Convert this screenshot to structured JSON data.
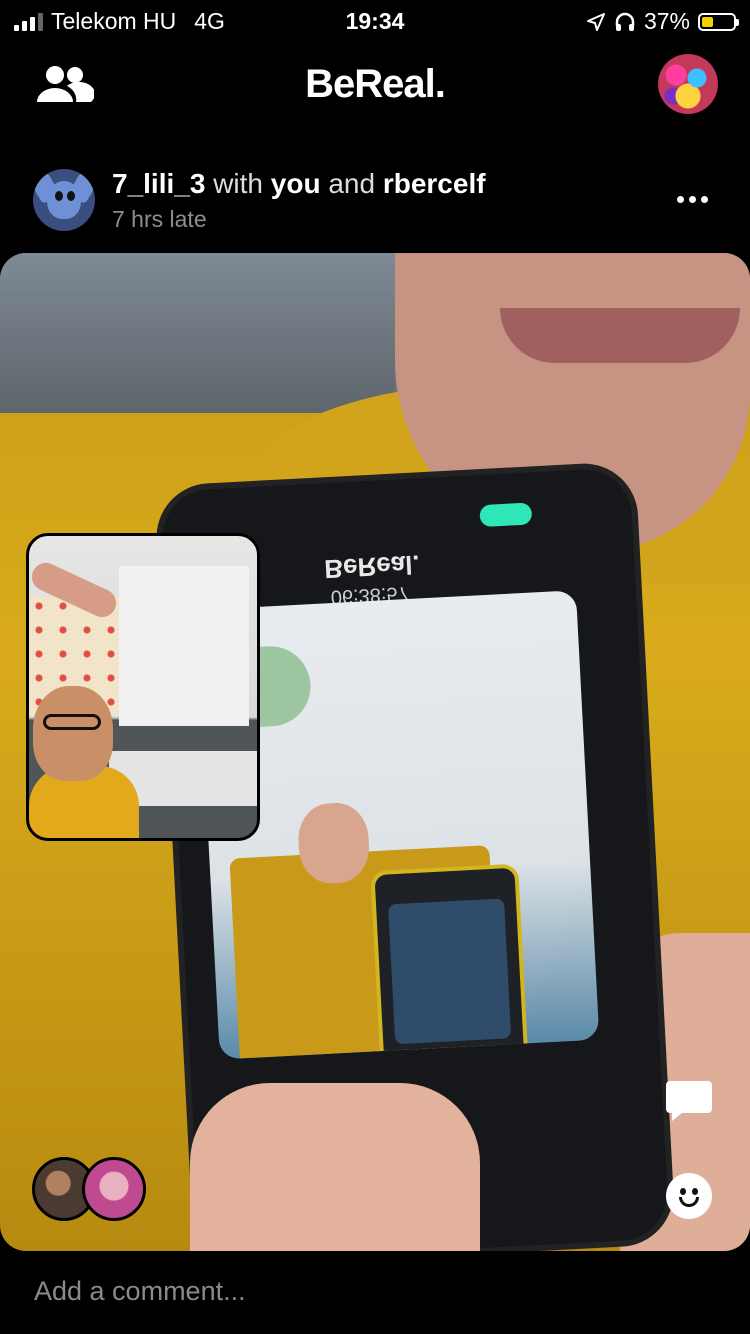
{
  "status_bar": {
    "carrier": "Telekom HU",
    "network": "4G",
    "time": "19:34",
    "battery": "37%",
    "battery_level": 0.37,
    "icons": [
      "location-icon",
      "headphones-icon",
      "battery-icon"
    ]
  },
  "header": {
    "logo": "BeReal.",
    "left_icon": "friends-icon",
    "right_icon": "profile-avatar"
  },
  "post": {
    "username": "7_lili_3",
    "with_word": "with",
    "tagged_you": "you",
    "and_word": "and",
    "other_user": "rbercelf",
    "late_text": "7 hrs late",
    "phone_screen_title": "BeReal.",
    "phone_screen_time": "06:38:57",
    "actions": [
      "more-icon",
      "comment-icon",
      "reaction-icon"
    ]
  },
  "comment": {
    "placeholder": "Add a comment..."
  },
  "colors": {
    "background": "#000000",
    "battery_accent": "#f5d000",
    "muted_text": "#8e8e8e"
  }
}
